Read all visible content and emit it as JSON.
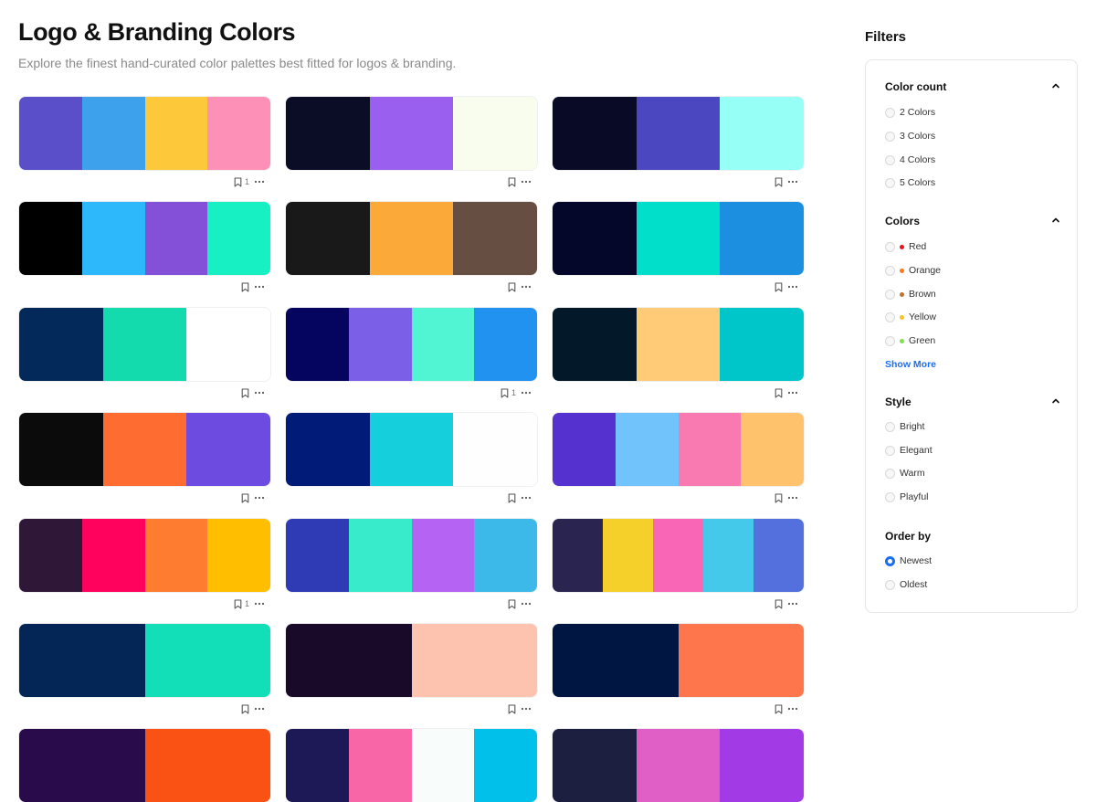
{
  "header": {
    "title": "Logo & Branding Colors",
    "subtitle": "Explore the finest hand-curated color palettes best fitted for logos & branding."
  },
  "palettes": [
    {
      "colors": [
        "#5b4fc9",
        "#3da1ec",
        "#fec83b",
        "#fd90b6"
      ],
      "likes": "1"
    },
    {
      "colors": [
        "#0b0c26",
        "#9b5ff0",
        "#f8fdee"
      ],
      "likes": ""
    },
    {
      "colors": [
        "#080a26",
        "#4a47c1",
        "#96fff6"
      ],
      "likes": ""
    },
    {
      "colors": [
        "#000000",
        "#2eb8fc",
        "#8450d8",
        "#16f0c3"
      ],
      "likes": ""
    },
    {
      "colors": [
        "#19191a",
        "#fbaa3a",
        "#674e42"
      ],
      "likes": ""
    },
    {
      "colors": [
        "#05072a",
        "#01dfcb",
        "#1d8fe0"
      ],
      "likes": ""
    },
    {
      "colors": [
        "#03295a",
        "#13dbae",
        "#ffffff"
      ],
      "likes": ""
    },
    {
      "colors": [
        "#05055f",
        "#7c5fe7",
        "#51f5d3",
        "#2292f0"
      ],
      "likes": "1"
    },
    {
      "colors": [
        "#031828",
        "#ffcb76",
        "#00c5c9"
      ],
      "likes": ""
    },
    {
      "colors": [
        "#0b0b0b",
        "#ff6c31",
        "#6d4ae0"
      ],
      "likes": ""
    },
    {
      "colors": [
        "#011c78",
        "#15d0dc",
        "#fefefe"
      ],
      "likes": ""
    },
    {
      "colors": [
        "#5532cf",
        "#71c3fb",
        "#f97ab1",
        "#fec26d"
      ],
      "likes": ""
    },
    {
      "colors": [
        "#2e1737",
        "#ff025d",
        "#fe7c30",
        "#ffbe00"
      ],
      "likes": "1"
    },
    {
      "colors": [
        "#2f3ab5",
        "#38ebca",
        "#b563f2",
        "#3cb9e8"
      ],
      "likes": ""
    },
    {
      "colors": [
        "#2a2550",
        "#f5d02b",
        "#f866b5",
        "#44c9ea",
        "#5470dc"
      ],
      "likes": ""
    },
    {
      "colors": [
        "#042656",
        "#12dfb7"
      ],
      "likes": ""
    },
    {
      "colors": [
        "#190a29",
        "#fec3ae"
      ],
      "likes": ""
    },
    {
      "colors": [
        "#001642",
        "#fe764b"
      ],
      "likes": ""
    },
    {
      "colors": [
        "#290b4c",
        "#fa5115"
      ],
      "likes": ""
    },
    {
      "colors": [
        "#1c1956",
        "#f966a7",
        "#f8fdfb",
        "#01c0e9"
      ],
      "likes": ""
    },
    {
      "colors": [
        "#1d1f40",
        "#df5fc6",
        "#a23be6"
      ],
      "likes": ""
    }
  ],
  "filters": {
    "title": "Filters",
    "color_count": {
      "title": "Color count",
      "options": [
        "2 Colors",
        "3 Colors",
        "4 Colors",
        "5 Colors"
      ]
    },
    "colors": {
      "title": "Colors",
      "options": [
        {
          "label": "Red",
          "color": "#e8141c"
        },
        {
          "label": "Orange",
          "color": "#ff7a1a"
        },
        {
          "label": "Brown",
          "color": "#c0722e"
        },
        {
          "label": "Yellow",
          "color": "#fbc41a"
        },
        {
          "label": "Green",
          "color": "#7de34a"
        }
      ],
      "show_more": "Show More"
    },
    "style": {
      "title": "Style",
      "options": [
        "Bright",
        "Elegant",
        "Warm",
        "Playful"
      ]
    },
    "order_by": {
      "title": "Order by",
      "options": [
        "Newest",
        "Oldest"
      ],
      "selected": "Newest"
    }
  },
  "accent_color": "#1a6ef5"
}
